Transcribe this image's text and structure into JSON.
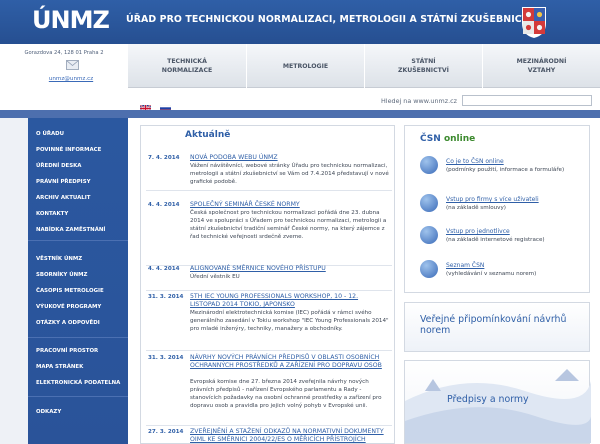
{
  "header": {
    "logo": "ÚNMZ",
    "title": "ÚŘAD PRO TECHNICKOU NORMALIZACI, METROLOGII A STÁTNÍ ZKUŠEBNICTVÍ",
    "brand_color": "#2f5fa7"
  },
  "contact": {
    "address": "Gorazdova 24, 128 01 Praha 2",
    "email": "unmz@unmz.cz",
    "icon": "envelope-icon"
  },
  "topnav": [
    {
      "line1": "TECHNICKÁ",
      "line2": "NORMALIZACE"
    },
    {
      "line1": "METROLOGIE",
      "line2": ""
    },
    {
      "line1": "STÁTNÍ",
      "line2": "ZKUŠEBNICTVÍ"
    },
    {
      "line1": "MEZINÁRODNÍ",
      "line2": "VZTAHY"
    }
  ],
  "languages": [
    {
      "icon": "uk-flag-icon"
    },
    {
      "icon": "ru-flag-icon"
    }
  ],
  "search": {
    "label": "Hledej na www.unmz.cz",
    "value": ""
  },
  "sidebar": {
    "items": [
      "O ÚŘADU",
      "POVINNÉ INFORMACE",
      "ÚŘEDNÍ DESKA",
      "PRÁVNÍ PŘEDPISY",
      "ARCHIV AKTUALIT",
      "KONTAKTY",
      "NABÍDKA ZAMĚSTNÁNÍ",
      "VĚSTNÍK ÚNMZ",
      "SBORNÍKY ÚNMZ",
      "ČASOPIS METROLOGIE",
      "VÝUKOVÉ PROGRAMY",
      "OTÁZKY A ODPOVĚDI",
      "PRACOVNÍ PROSTOR",
      "MAPA STRÁNEK",
      "ELEKTRONICKÁ PODATELNA",
      "ODKAZY"
    ]
  },
  "news": {
    "title": "Aktuálně",
    "items": [
      {
        "date": "7. 4. 2014",
        "title": "NOVÁ PODOBA WEBU ÚNMZ",
        "body": "Vážení návštěvníci, webové stránky Úřadu pro technickou normalizaci, metrologii a státní zkušebnictví se Vám od 7.4.2014 představují v nové grafické podobě."
      },
      {
        "date": "4. 4. 2014",
        "title": "SPOLEČNÝ SEMINÁŘ ČESKÉ NORMY",
        "body": "Česká společnost pro technickou normalizaci pořádá dne 23. dubna 2014 ve spolupráci s Úřadem pro technickou normalizaci, metrologii a státní zkušebnictví tradiční seminář České normy, na který zájemce z řad technické veřejnosti srdečně zveme."
      },
      {
        "date": "4. 4. 2014",
        "title": "ALIGNOVANÉ SMĚRNICE NOVÉHO PŘÍSTUPU",
        "body": "Úřední věstník EU"
      },
      {
        "date": "31. 3. 2014",
        "title": "5TH IEC YOUNG PROFESSIONALS WORKSHOP, 10 - 12. LISTOPAD 2014 TOKIO, JAPONSKO",
        "body": "Mezinárodní elektrotechnická komise (IEC) pořádá v rámci svého generálního zasedání v Tokiu workshop \"IEC Young Professionals 2014\" pro mladé inženýry, techniky, manažery a obchodníky."
      },
      {
        "date": "31. 3. 2014",
        "title": "NÁVRHY NOVÝCH PRÁVNÍCH PŘEDPISŮ V OBLASTI OSOBNÍCH OCHRANNÝCH PROSTŘEDKŮ A ZAŘÍZENÍ PRO DOPRAVU OSOB",
        "body": "Evropská komise dne 27. března 2014 zveřejnila návrhy nových právních předpisů - nařízení Evropského parlamentu a Rady - stanovících požadavky na osobní ochranné prostředky a zařízení pro dopravu osob a pravidla pro jejich volný pohyb v Evropské unii."
      },
      {
        "date": "27. 3. 2014",
        "title": "ZVEŘEJNĚNÍ A STAŽENÍ ODKAZŮ NA NORMATIVNÍ DOKUMENTY OIML KE SMĚRNICI 2004/22/ES O MĚŘICÍCH PŘÍSTROJÍCH",
        "body": ""
      }
    ]
  },
  "csn": {
    "title_main": "ČSN",
    "title_accent": "online",
    "accent_color": "#3c8a2e",
    "links": [
      {
        "label": "Co je to ČSN online",
        "sub": "(podmínky použití, informace a formuláře)",
        "icon": "info-globe-icon"
      },
      {
        "label": "Vstup pro firmy s více uživateli",
        "sub": "(na základě smlouvy)",
        "icon": "users-globe-icon"
      },
      {
        "label": "Vstup pro jednotlivce",
        "sub": "(na základě internetové registrace)",
        "icon": "user-globe-icon"
      },
      {
        "label": "Seznam ČSN",
        "sub": "(vyhledávání v seznamu norem)",
        "icon": "list-globe-icon"
      }
    ]
  },
  "public_comment": {
    "label": "Veřejné připomínkování návrhů norem"
  },
  "regulations": {
    "label": "Předpisy a normy"
  }
}
